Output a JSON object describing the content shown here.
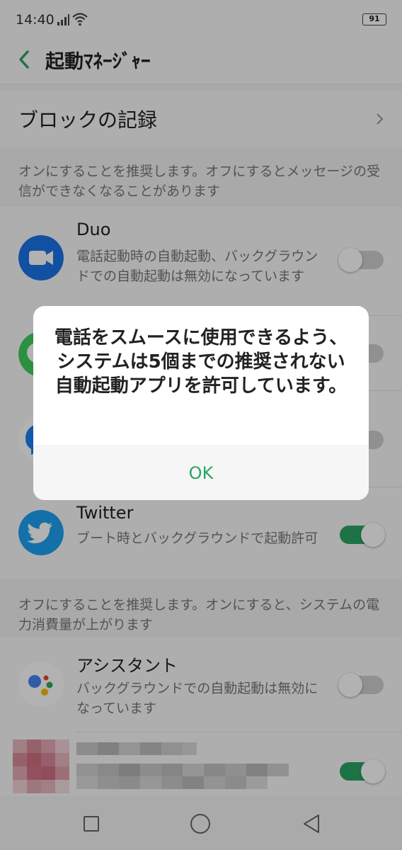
{
  "status": {
    "time": "14:40",
    "battery": "91"
  },
  "header": {
    "title": "起動ﾏﾈｰｼﾞｬｰ"
  },
  "block_record": {
    "label": "ブロックの記録"
  },
  "sections": {
    "recommend_on": "オンにすることを推奨します。オフにするとメッセージの受信ができなくなることがあります",
    "recommend_off": "オフにすることを推奨します。オンにすると、システムの電力消費量が上がります"
  },
  "apps": {
    "duo": {
      "name": "Duo",
      "desc": "電話起動時の自動起動、バックグラウンドでの自動起動は無効になっています",
      "enabled": false
    },
    "line": {
      "enabled": false
    },
    "messenger": {
      "enabled": false
    },
    "twitter": {
      "name": "Twitter",
      "desc": "ブート時とバックグラウンドで起動許可",
      "enabled": true
    },
    "assistant": {
      "name": "アシスタント",
      "desc": "バックグラウンドでの自動起動は無効になっています",
      "enabled": false
    },
    "hidden_app": {
      "enabled": true
    }
  },
  "dialog": {
    "message": "電話をスムースに使用できるよう、システムは5個までの推奨されない自動起動アプリを許可しています。",
    "ok_label": "OK"
  },
  "colors": {
    "accent": "#2aa565",
    "duo": "#1a73e8",
    "twitter": "#1da1f2",
    "line": "#3ecf5c"
  }
}
